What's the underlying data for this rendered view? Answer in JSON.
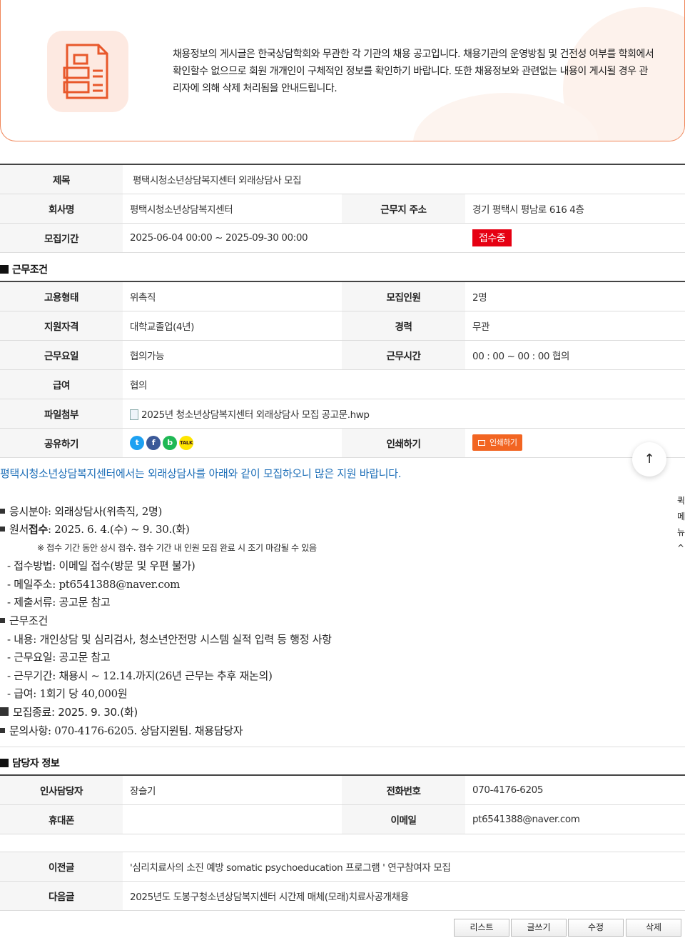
{
  "notice": {
    "text": "채용정보의 게시글은 한국상담학회와 무관한 각 기관의 채용 공고입니다. 채용기관의 운영방침 및 건전성 여부를 학회에서 확인할수 없으므로 회원 개개인이 구체적인 정보를 확인하기 바랍니다. 또한 채용정보와 관련없는 내용이 게시될 경우 관리자에 의해 삭제 처리됨을 안내드립니다."
  },
  "info": {
    "title_label": "제목",
    "title_value": "평택시청소년상담복지센터 외래상담사 모집",
    "company_label": "회사명",
    "company_value": "평택시청소년상담복지센터",
    "address_label": "근무지 주소",
    "address_value": "경기 평택시 평남로 616 4층",
    "period_label": "모집기간",
    "period_value": "2025-06-04 00:00 ~ 2025-09-30 00:00",
    "status": "접수중",
    "status_color": "#e60012"
  },
  "conditions": {
    "section_title": "근무조건",
    "employment_label": "고용형태",
    "employment_value": "위촉직",
    "headcount_label": "모집인원",
    "headcount_value": "2명",
    "qualification_label": "지원자격",
    "qualification_value": "대학교졸업(4년)",
    "career_label": "경력",
    "career_value": "무관",
    "days_label": "근무요일",
    "days_value": "협의가능",
    "hours_label": "근무시간",
    "hours_value": "00 : 00 ~ 00 : 00 협의",
    "salary_label": "급여",
    "salary_value": "협의",
    "file_label": "파일첨부",
    "file_value": "2025년 청소년상담복지센터 외래상담사 모집 공고문.hwp",
    "share_label": "공유하기",
    "share_icons": [
      "twitter-icon",
      "facebook-icon",
      "band-icon",
      "kakaotalk-icon"
    ],
    "print_label": "인쇄하기",
    "print_button": "인쇄하기"
  },
  "body": {
    "intro": "평택시청소년상담복지센터에서는 외래상담사를 아래와 같이 모집하오니 많은 지원 바랍니다.",
    "l1": "응시분야: 외래상담사(위촉직, 2명)",
    "l2a": "원서",
    "l2b": "접수",
    "l2c": ": 2025. 6. 4.(수) ~ 9. 30.(화)",
    "l3": "※ 접수 기간 동안 상시 접수. 접수 기간 내 인원 모집 완료 시 조기 마감될 수 있음",
    "l4": "- 접수방법: 이메일 접수(방문 및 우편 불가)",
    "l5": "- 메일주소: pt6541388@naver.com",
    "l6": "- 제출서류: 공고문 참고",
    "l7": "근무조건",
    "l8": "- 내용: 개인상담 및 심리검사, 청소년안전망 시스템 실적 입력 등 행정 사항",
    "l9": "- 근무요일: 공고문 참고",
    "l10": "- 근무기간: 채용시 ~ 12.14.까지(26년 근무는 추후 재논의)",
    "l11": "- 급여: 1회기 당 40,000원",
    "l12": "모집종료: 2025. 9. 30.(화)",
    "l13": "문의사항: 070-4176-6205. 상담지원팀. 채용담당자"
  },
  "manager": {
    "section_title": "담당자 정보",
    "hr_label": "인사담당자",
    "hr_value": "장슬기",
    "phone_label": "전화번호",
    "phone_value": "070-4176-6205",
    "mobile_label": "휴대폰",
    "mobile_value": "",
    "email_label": "이메일",
    "email_value": "pt6541388@naver.com"
  },
  "nav": {
    "prev_label": "이전글",
    "prev_value": "'심리치료사의 소진 예방 somatic psychoeducation 프로그램 ' 연구참여자 모집",
    "next_label": "다음글",
    "next_value": "2025년도 도봉구청소년상담복지센터 시간제 매체(모래)치료사공개채용"
  },
  "buttons": {
    "list": "리스트",
    "write": "글쓰기",
    "edit": "수정",
    "delete": "삭제"
  },
  "floating": {
    "top_icon": "arrow-up-icon",
    "side_menu": [
      "퀵",
      "메",
      "뉴",
      "^"
    ]
  }
}
